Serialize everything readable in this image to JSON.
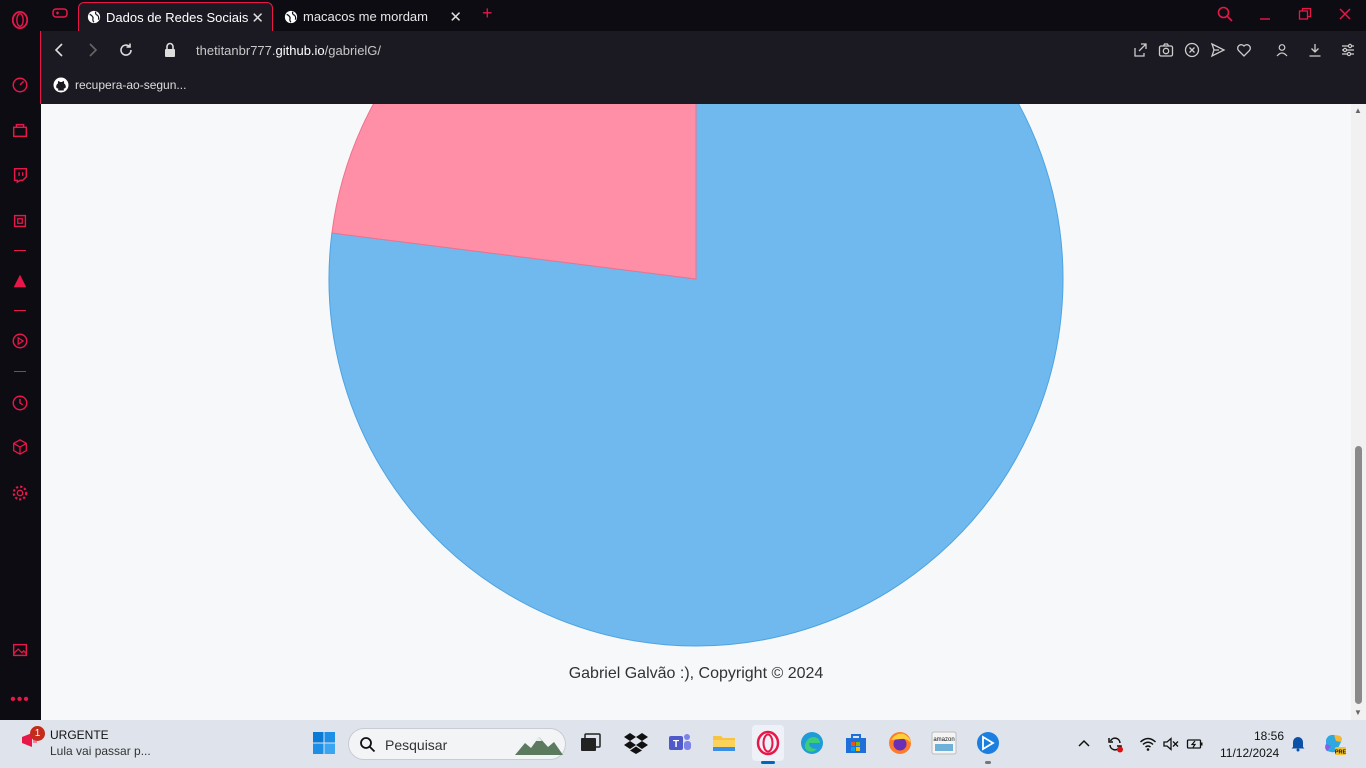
{
  "browser": {
    "tabs": [
      {
        "title": "Dados de Redes Sociais",
        "active": true
      },
      {
        "title": "macacos me mordam",
        "active": false
      }
    ],
    "url_prefix": "thetitanbr777.",
    "url_domain": "github.io",
    "url_path": "/gabrielG/",
    "bookmark": "recupera-ao-segun..."
  },
  "page": {
    "footer": "Gabriel Galvão :), Copyright © 2024"
  },
  "chart_data": {
    "type": "pie",
    "slices": [
      {
        "label": "",
        "value": 77,
        "color": "#6fb9ee"
      },
      {
        "label": "",
        "value": 23,
        "color": "#ff8fa6"
      }
    ]
  },
  "taskbar": {
    "news_badge": "1",
    "news_title": "URGENTE",
    "news_sub": "Lula vai passar p...",
    "search_placeholder": "Pesquisar",
    "time": "18:56",
    "date": "11/12/2024"
  },
  "colors": {
    "accent": "#e8174a",
    "pie_blue": "#6fb9ee",
    "pie_pink": "#ff8fa6"
  }
}
